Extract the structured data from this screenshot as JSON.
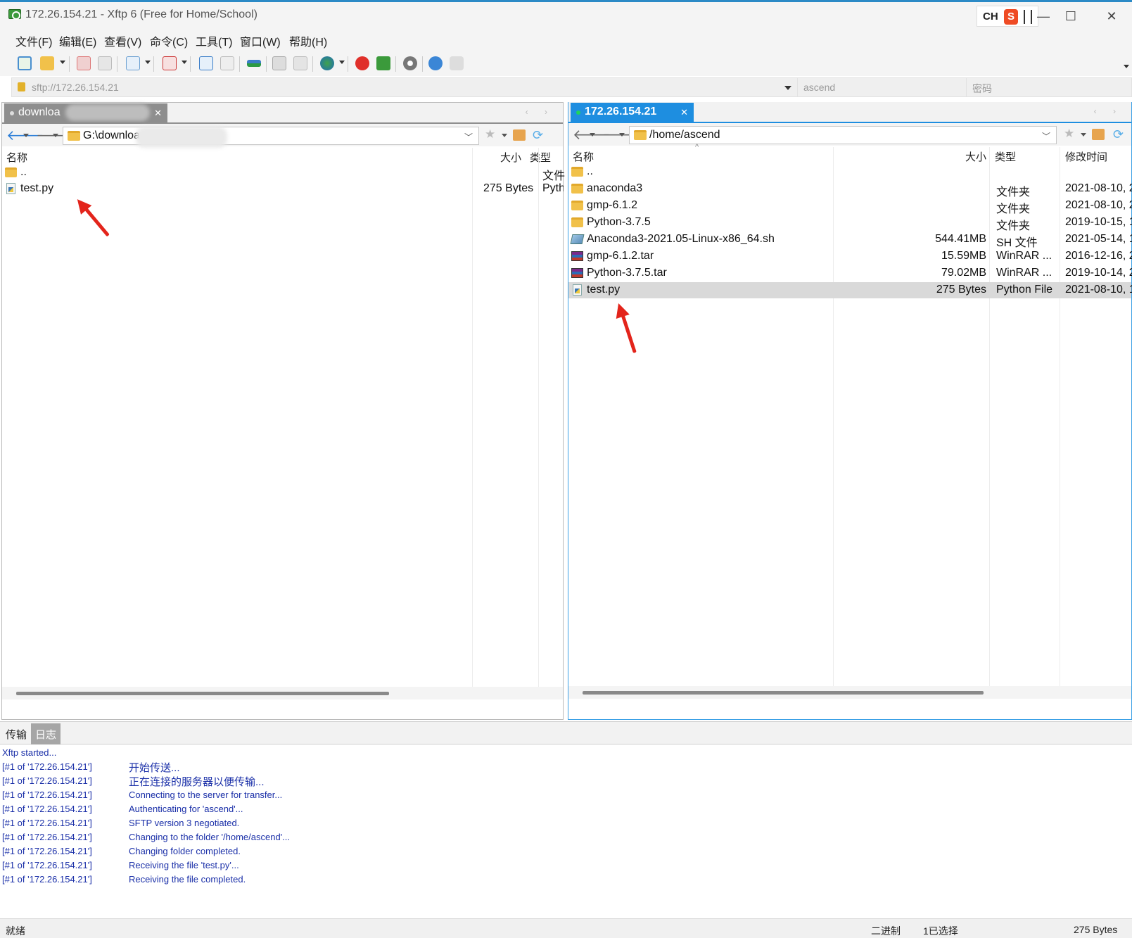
{
  "window": {
    "title": "172.26.154.21 - Xftp 6 (Free for Home/School)",
    "ime_label": "CH",
    "ime_logo": "S",
    "minimize": "—",
    "maximize": "☐",
    "close": "✕"
  },
  "menu": [
    "文件(F)",
    "编辑(E)",
    "查看(V)",
    "命令(C)",
    "工具(T)",
    "窗口(W)",
    "帮助(H)"
  ],
  "toolbar_icons": [
    "new-session-icon",
    "open-folder-icon",
    "connect-icon",
    "disconnect-icon",
    "new-tab-icon",
    "play-icon",
    "upload-icon",
    "download-icon",
    "transfer-icon",
    "copy-icon",
    "paste-icon",
    "globe-icon",
    "xshell-icon",
    "xftp-icon",
    "settings-icon",
    "help-icon",
    "chat-icon"
  ],
  "address": {
    "url": "sftp://172.26.154.21",
    "username_placeholder": "ascend",
    "password_placeholder": "密码"
  },
  "left_pane": {
    "tab_label": "downloa",
    "path": "G:\\downloa",
    "columns": [
      "名称",
      "大小",
      "类型"
    ],
    "rows": [
      {
        "name": "..",
        "size": "",
        "type": "文件",
        "icon": "folder"
      },
      {
        "name": "test.py",
        "size": "275 Bytes",
        "type": "Pyth",
        "icon": "python-file"
      }
    ]
  },
  "right_pane": {
    "tab_label": "172.26.154.21",
    "path": "/home/ascend",
    "columns": [
      "名称",
      "大小",
      "类型",
      "修改时间"
    ],
    "rows": [
      {
        "name": "..",
        "size": "",
        "type": "",
        "modified": "",
        "icon": "folder"
      },
      {
        "name": "anaconda3",
        "size": "",
        "type": "文件夹",
        "modified": "2021-08-10, 2",
        "icon": "folder"
      },
      {
        "name": "gmp-6.1.2",
        "size": "",
        "type": "文件夹",
        "modified": "2021-08-10, 2",
        "icon": "folder"
      },
      {
        "name": "Python-3.7.5",
        "size": "",
        "type": "文件夹",
        "modified": "2019-10-15, 1",
        "icon": "folder"
      },
      {
        "name": "Anaconda3-2021.05-Linux-x86_64.sh",
        "size": "544.41MB",
        "type": "SH 文件",
        "modified": "2021-05-14, 1",
        "icon": "sh-file"
      },
      {
        "name": "gmp-6.1.2.tar",
        "size": "15.59MB",
        "type": "WinRAR ...",
        "modified": "2016-12-16, 2",
        "icon": "rar-file"
      },
      {
        "name": "Python-3.7.5.tar",
        "size": "79.02MB",
        "type": "WinRAR ...",
        "modified": "2019-10-14, 2",
        "icon": "rar-file"
      },
      {
        "name": "test.py",
        "size": "275 Bytes",
        "type": "Python File",
        "modified": "2021-08-10, 1",
        "icon": "python-file",
        "selected": true
      }
    ]
  },
  "log": {
    "tabs": [
      "传输",
      "日志"
    ],
    "active_tab": "日志",
    "lines": [
      {
        "src": "Xftp started...",
        "msg": ""
      },
      {
        "src": "[#1 of '172.26.154.21']",
        "msg": "开始传送..."
      },
      {
        "src": "[#1 of '172.26.154.21']",
        "msg": "正在连接的服务器以便传输..."
      },
      {
        "src": "[#1 of '172.26.154.21']",
        "msg": "Connecting to the server for transfer..."
      },
      {
        "src": "[#1 of '172.26.154.21']",
        "msg": "Authenticating for 'ascend'..."
      },
      {
        "src": "[#1 of '172.26.154.21']",
        "msg": "SFTP version 3 negotiated."
      },
      {
        "src": "[#1 of '172.26.154.21']",
        "msg": "Changing to the folder '/home/ascend'..."
      },
      {
        "src": "[#1 of '172.26.154.21']",
        "msg": "Changing folder completed."
      },
      {
        "src": "[#1 of '172.26.154.21']",
        "msg": "Receiving the file 'test.py'..."
      },
      {
        "src": "[#1 of '172.26.154.21']",
        "msg": "Receiving the file completed."
      }
    ]
  },
  "status": {
    "ready": "就绪",
    "mode": "二进制",
    "selection": "1已选择",
    "size": "275 Bytes"
  },
  "colors": {
    "accent": "#1e8ee0",
    "annotation": "#e3241b",
    "log_text": "#1a2fa8"
  }
}
